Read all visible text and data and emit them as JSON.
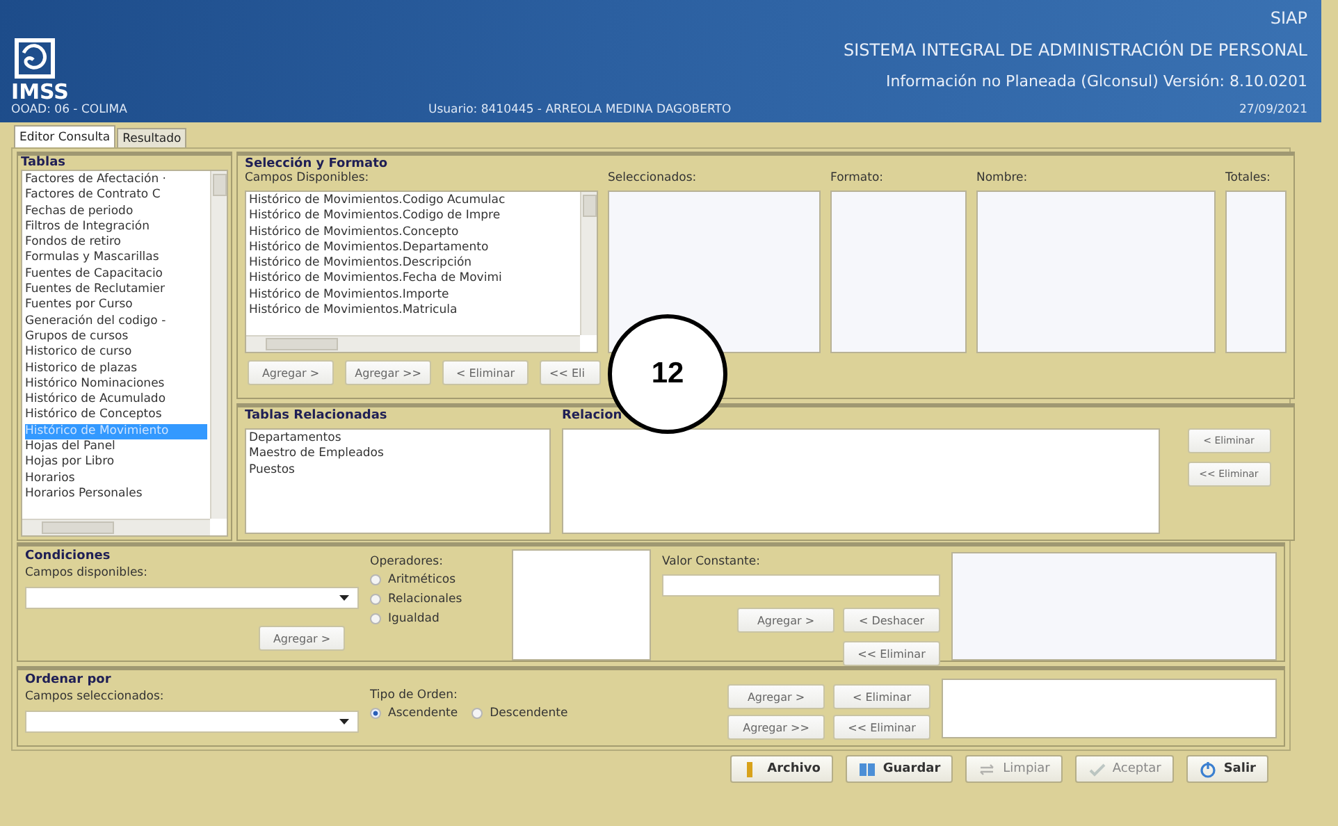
{
  "header": {
    "logo_text": "IMSS",
    "office": "OOAD: 06 - COLIMA",
    "user": "Usuario: 8410445 - ARREOLA MEDINA DAGOBERTO",
    "app_name": "SIAP",
    "system": "SISTEMA INTEGRAL DE ADMINISTRACIÓN DE PERSONAL",
    "module": "Información no Planeada (Glconsul) Versión: 8.10.0201",
    "date": "27/09/2021"
  },
  "tabs": [
    {
      "label": "Editor Consulta",
      "selected": true
    },
    {
      "label": "Resultado",
      "selected": false
    }
  ],
  "tables": {
    "title": "Tablas",
    "items": [
      {
        "label": "Factores de Afectación ·",
        "selected": false
      },
      {
        "label": "Factores de Contrato C",
        "selected": false
      },
      {
        "label": "Fechas de periodo",
        "selected": false
      },
      {
        "label": "Filtros de Integración",
        "selected": false
      },
      {
        "label": "Fondos de retiro",
        "selected": false
      },
      {
        "label": "Formulas y Mascarillas",
        "selected": false
      },
      {
        "label": "Fuentes de Capacitacio",
        "selected": false
      },
      {
        "label": "Fuentes de Reclutamier",
        "selected": false
      },
      {
        "label": "Fuentes por Curso",
        "selected": false
      },
      {
        "label": "Generación del codigo -",
        "selected": false
      },
      {
        "label": "Grupos de cursos",
        "selected": false
      },
      {
        "label": "Historico de curso",
        "selected": false
      },
      {
        "label": "Historico de plazas",
        "selected": false
      },
      {
        "label": "Histórico Nominaciones",
        "selected": false
      },
      {
        "label": "Histórico de Acumulado",
        "selected": false
      },
      {
        "label": "Histórico de Conceptos",
        "selected": false
      },
      {
        "label": "Histórico de Movimiento",
        "selected": true
      },
      {
        "label": "Hojas del Panel",
        "selected": false
      },
      {
        "label": "Hojas por Libro",
        "selected": false
      },
      {
        "label": "Horarios",
        "selected": false
      },
      {
        "label": "Horarios Personales",
        "selected": false
      }
    ]
  },
  "selection": {
    "title": "Selección y Formato",
    "available_label": "Campos Disponibles:",
    "available": [
      "Histórico de Movimientos.Codigo Acumulac",
      "Histórico de Movimientos.Codigo de Impre",
      "Histórico de Movimientos.Concepto",
      "Histórico de Movimientos.Departamento",
      "Histórico de Movimientos.Descripción",
      "Histórico de Movimientos.Fecha de Movimi",
      "Histórico de Movimientos.Importe",
      "Histórico de Movimientos.Matricula"
    ],
    "columns": [
      "Seleccionados:",
      "Formato:",
      "Nombre:",
      "Totales:"
    ],
    "buttons": [
      "Agregar >",
      "Agregar >>",
      "< Eliminar",
      "<< Eli"
    ]
  },
  "related": {
    "title": "Tablas Relacionadas",
    "items": [
      "Departamentos",
      "Maestro de Empleados",
      "Puestos"
    ],
    "relations_title": "Relacion",
    "buttons": [
      "< Eliminar",
      "<< Eliminar"
    ]
  },
  "conditions": {
    "title": "Condiciones",
    "fields_label": "Campos disponibles:",
    "add_button": "Agregar >",
    "operators_label": "Operadores:",
    "operators": [
      {
        "label": "Aritméticos",
        "selected": false
      },
      {
        "label": "Relacionales",
        "selected": false
      },
      {
        "label": "Igualdad",
        "selected": false
      }
    ],
    "constant_label": "Valor Constante:",
    "buttons": [
      "Agregar >",
      "< Deshacer",
      "<< Eliminar"
    ]
  },
  "sort": {
    "title": "Ordenar por",
    "fields_label": "Campos seleccionados:",
    "order_label": "Tipo de Orden:",
    "orders": [
      {
        "label": "Ascendente",
        "selected": true
      },
      {
        "label": "Descendente",
        "selected": false
      }
    ],
    "buttons": [
      "Agregar >",
      "< Eliminar",
      "Agregar >>",
      "<< Eliminar"
    ]
  },
  "actions": [
    {
      "label": "Archivo",
      "disabled": false
    },
    {
      "label": "Guardar",
      "disabled": false
    },
    {
      "label": "Limpiar",
      "disabled": true
    },
    {
      "label": "Aceptar",
      "disabled": true
    },
    {
      "label": "Salir",
      "disabled": false
    }
  ],
  "callout": {
    "label": "12"
  }
}
